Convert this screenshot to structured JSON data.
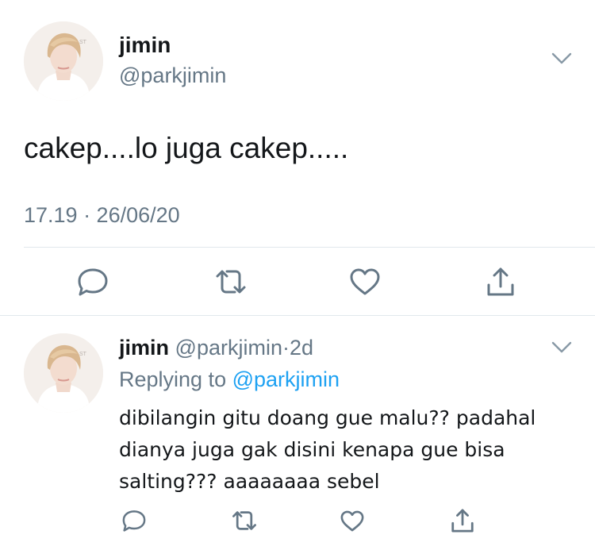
{
  "main_tweet": {
    "author_name": "jimin",
    "author_handle": "@parkjimin",
    "text": "cakep....lo juga cakep.....",
    "timestamp": "17.19 · 26/06/20",
    "icons": {
      "avatar": "profile-photo",
      "menu": "chevron-down-icon",
      "reply": "reply-bubble-icon",
      "retweet": "retweet-icon",
      "like": "heart-icon",
      "share": "share-icon"
    }
  },
  "reply_tweet": {
    "author_name": "jimin",
    "author_handle": "@parkjimin",
    "separator": "·",
    "age": "2d",
    "replying_prefix": "Replying to",
    "replying_handle": "@parkjimin",
    "text_lines": [
      "dibilangin gitu doang gue malu?? padahal",
      "dianya juga gak disini kenapa gue bisa",
      "salting??? aaaaaaaa sebel"
    ]
  },
  "colors": {
    "text_primary": "#14171a",
    "text_secondary": "#657786",
    "link": "#1da1f2",
    "divider": "#e1e8ed",
    "icon": "#657786"
  }
}
